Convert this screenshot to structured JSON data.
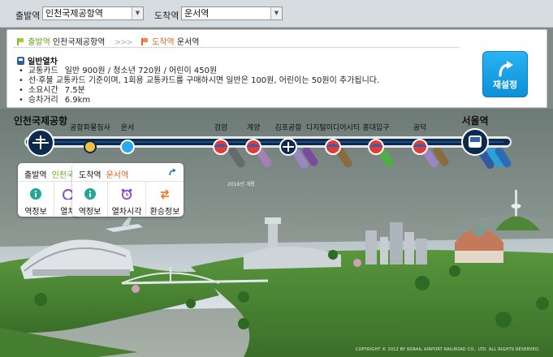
{
  "topbar": {
    "departure_label": "출발역",
    "departure_value": "인천국제공항역",
    "arrival_label": "도착역",
    "arrival_value": "운서역"
  },
  "info": {
    "route": {
      "departure_label": "출발역",
      "departure_station": "인천국제공항역",
      "separator": ">>>",
      "arrival_label": "도착역",
      "arrival_station": "운서역"
    },
    "train_type": "일반열차",
    "fares": [
      {
        "key": "교통카드",
        "value": "일반 900원 / 청소년 720원 / 어린이 450원"
      },
      {
        "key": "",
        "value": "선·후불 교통카드 기준이며, 1회용 교통카드를 구매하시면 일반은 100원, 어린이는 50원이 추가됩니다."
      },
      {
        "key": "소요시간",
        "value": "7.5분"
      },
      {
        "key": "승차거리",
        "value": "6.9km"
      }
    ],
    "reset_button": "재설정"
  },
  "stations": [
    {
      "name": "인천국제공항",
      "big": true
    },
    {
      "name": "공항화물청사"
    },
    {
      "name": "운서"
    },
    {
      "name": "검암"
    },
    {
      "name": "계양"
    },
    {
      "name": "김포공항"
    },
    {
      "name": "디지털미디어시티"
    },
    {
      "name": "홍대입구"
    },
    {
      "name": "공덕"
    },
    {
      "name": "서울역",
      "big": true
    }
  ],
  "station_note": "2016년 개통",
  "line_tags": [
    "인천1호선",
    "9호선",
    "5호선",
    "6호선",
    "2호선",
    "6호선",
    "1호선",
    "4호선",
    "KTX"
  ],
  "popup_departure": {
    "title_label": "출발역",
    "station": "인천국",
    "buttons": [
      "역정보",
      "열차"
    ]
  },
  "popup_arrival": {
    "title_label": "도착역",
    "station": "운서역",
    "buttons": [
      "역정보",
      "열차시각",
      "환승정보"
    ]
  },
  "copyright": "COPYRIGHT © 2012 BY KORAIL AIRPORT RAILROAD CO., LTD. ALL RIGHTS RESERVED.",
  "colors": {
    "accent": "#1c9be3",
    "line_main": "#0b2a4e",
    "departure_green": "#6aa51a",
    "arrival_orange": "#e06423"
  }
}
